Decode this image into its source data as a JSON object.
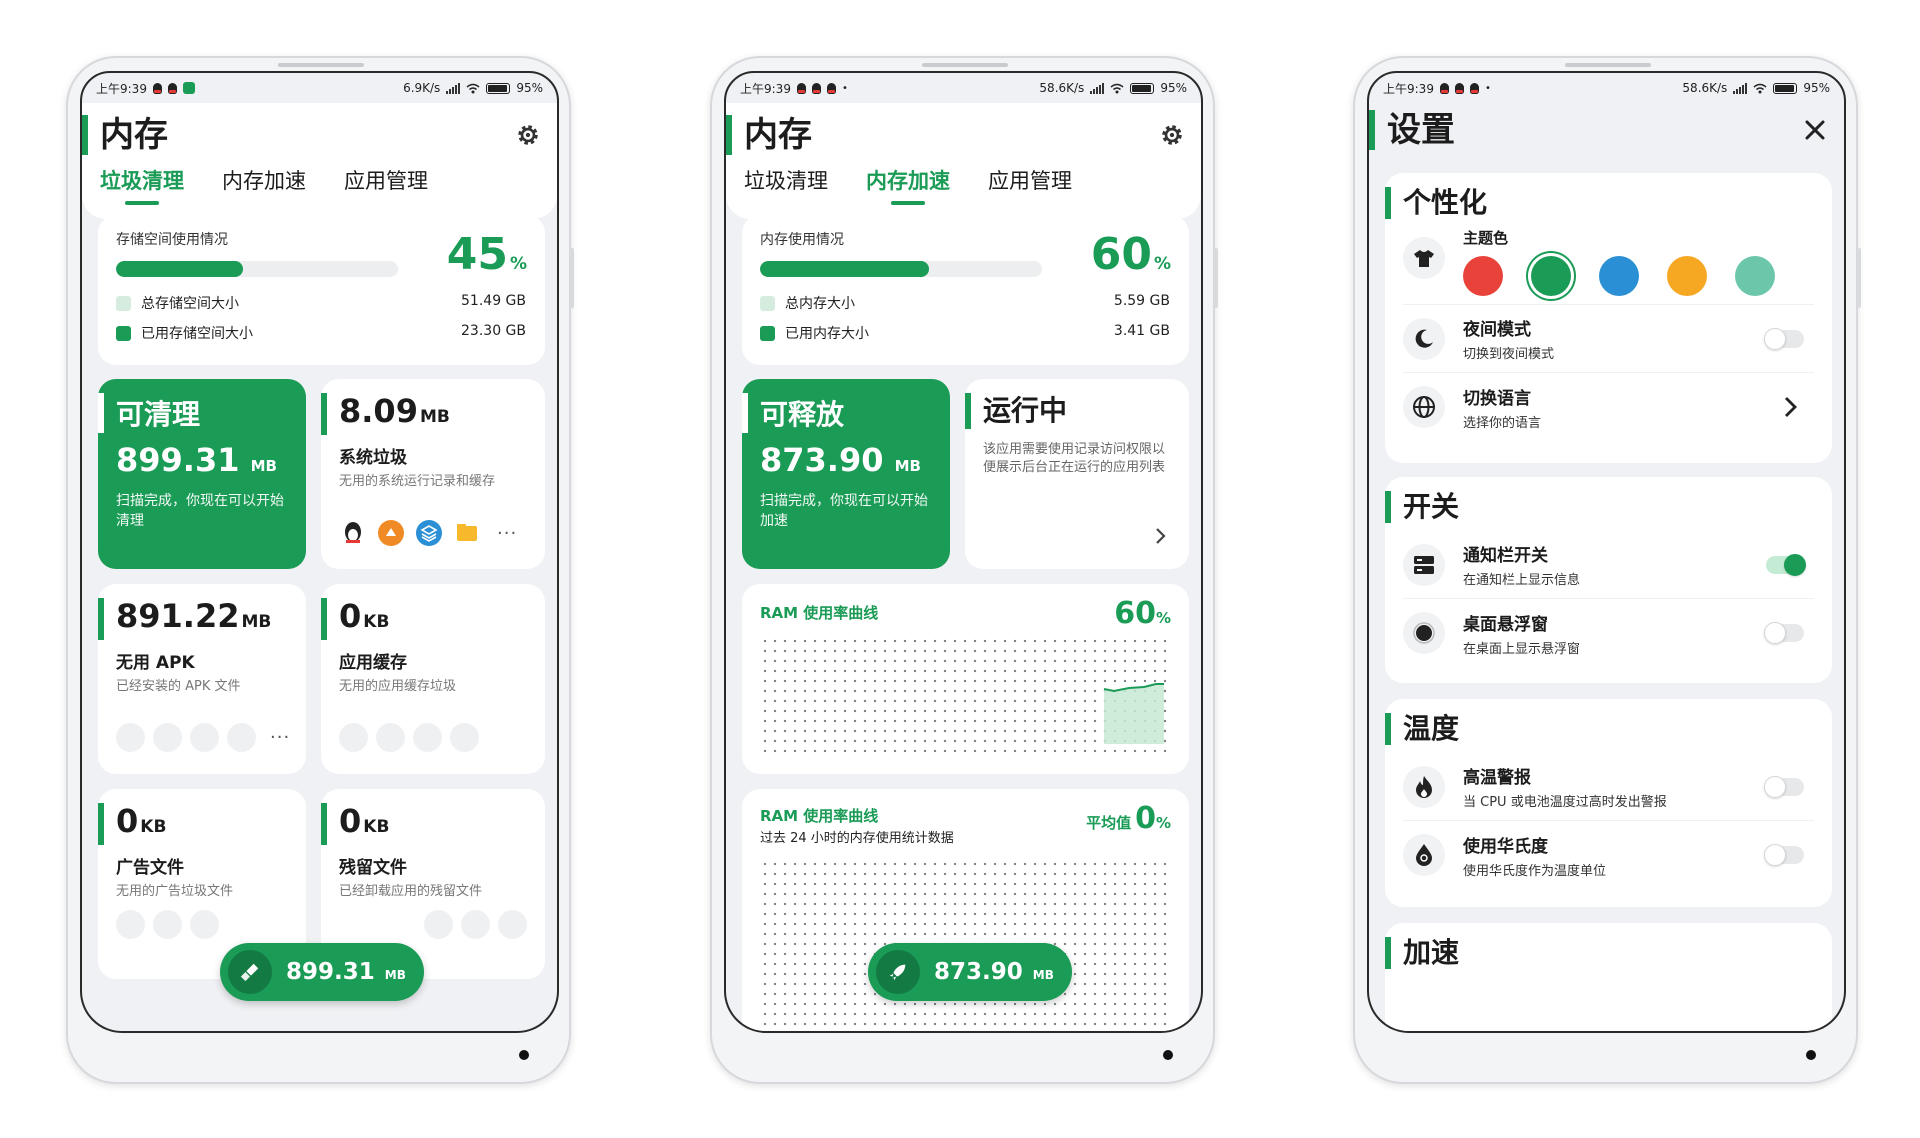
{
  "status_bars": [
    {
      "time": "上午9:39",
      "speed": "6.9K/s",
      "battery": "95"
    },
    {
      "time": "上午9:39",
      "speed": "58.6K/s",
      "battery": "95"
    },
    {
      "time": "上午9:39",
      "speed": "58.6K/s",
      "battery": "95"
    }
  ],
  "battery_unit": "%",
  "memory_title": "内存",
  "tabs": [
    "垃圾清理",
    "内存加速",
    "应用管理"
  ],
  "screen1": {
    "usage": {
      "label": "存储空间使用情况",
      "percent": "45",
      "percent_unit": "%",
      "fill_fraction": 0.45,
      "total_label": "总存储空间大小",
      "total_value": "51.49 GB",
      "used_label": "已用存储空间大小",
      "used_value": "23.30 GB"
    },
    "hero": {
      "title": "可清理",
      "value": "899.31",
      "unit": "MB",
      "desc": "扫描完成，你现在可以开始清理"
    },
    "tiles": [
      {
        "num": "8.09",
        "unit": "MB",
        "title": "系统垃圾",
        "desc": "无用的系统运行记录和缓存"
      },
      {
        "num": "891.22",
        "unit": "MB",
        "title": "无用 APK",
        "desc": "已经安装的 APK 文件"
      },
      {
        "num": "0",
        "unit": "KB",
        "title": "应用缓存",
        "desc": "无用的应用缓存垃圾"
      },
      {
        "num": "0",
        "unit": "KB",
        "title": "广告文件",
        "desc": "无用的广告垃圾文件"
      },
      {
        "num": "0",
        "unit": "KB",
        "title": "残留文件",
        "desc": "已经卸载应用的残留文件"
      }
    ],
    "more": "···",
    "fab": {
      "value": "899.31",
      "unit": "MB"
    }
  },
  "screen2": {
    "usage": {
      "label": "内存使用情况",
      "percent": "60",
      "percent_unit": "%",
      "fill_fraction": 0.6,
      "total_label": "总内存大小",
      "total_value": "5.59 GB",
      "used_label": "已用内存大小",
      "used_value": "3.41 GB"
    },
    "hero": {
      "title": "可释放",
      "value": "873.90",
      "unit": "MB",
      "desc": "扫描完成，你现在可以开始加速"
    },
    "running": {
      "title": "运行中",
      "desc": "该应用需要使用记录访问权限以便展示后台正在运行的应用列表"
    },
    "chart1": {
      "title": "RAM 使用率曲线",
      "percent": "60",
      "unit": "%"
    },
    "chart2": {
      "title": "RAM 使用率曲线",
      "subtitle": "过去 24 小时的内存使用统计数据",
      "avg_label": "平均值",
      "percent": "0",
      "unit": "%"
    },
    "fab": {
      "value": "873.90",
      "unit": "MB"
    }
  },
  "screen3": {
    "title": "设置",
    "sections": {
      "personal": {
        "title": "个性化",
        "theme_label": "主题色",
        "theme_colors": [
          "#e8423b",
          "#1a9b56",
          "#2a8fd4",
          "#f7a823",
          "#6cc7aa"
        ],
        "night_title": "夜间模式",
        "night_sub": "切换到夜间模式",
        "lang_title": "切换语言",
        "lang_sub": "选择你的语言"
      },
      "switches": {
        "title": "开关",
        "notif_title": "通知栏开关",
        "notif_sub": "在通知栏上显示信息",
        "float_title": "桌面悬浮窗",
        "float_sub": "在桌面上显示悬浮窗"
      },
      "temperature": {
        "title": "温度",
        "alarm_title": "高温警报",
        "alarm_sub": "当 CPU 或电池温度过高时发出警报",
        "fahr_title": "使用华氏度",
        "fahr_sub": "使用华氏度作为温度单位"
      },
      "speed": {
        "title": "加速"
      }
    }
  }
}
